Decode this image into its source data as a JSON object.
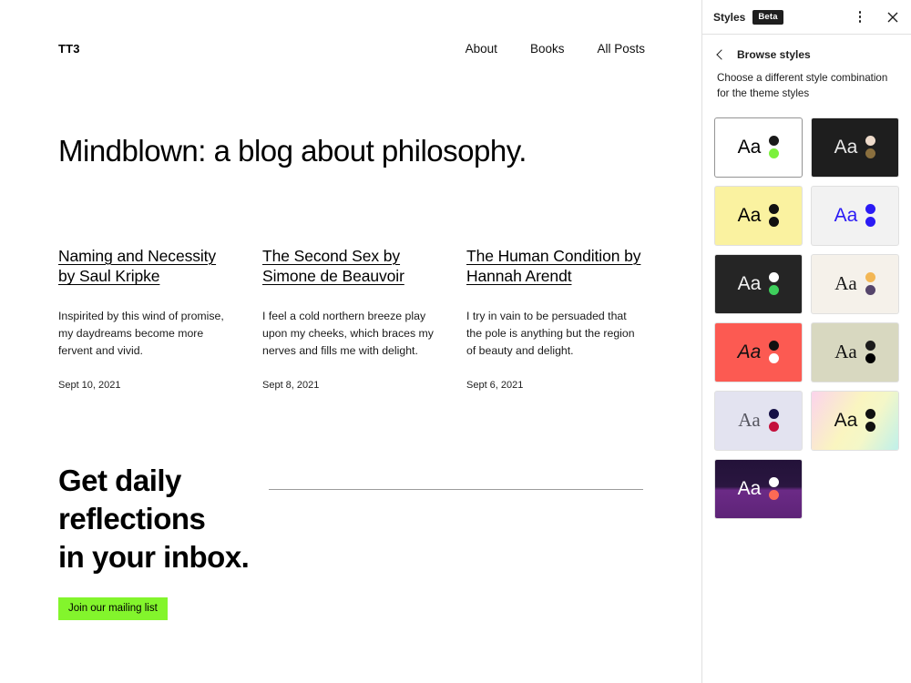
{
  "site": {
    "title": "TT3",
    "nav": [
      {
        "label": "About"
      },
      {
        "label": "Books"
      },
      {
        "label": "All Posts"
      }
    ],
    "hero": "Mindblown: a blog about philosophy.",
    "posts": [
      {
        "title": "Naming and Necessity by Saul Kripke",
        "excerpt": "Inspirited by this wind of promise, my daydreams become more fervent and vivid.",
        "date": "Sept 10, 2021"
      },
      {
        "title": "The Second Sex by Simone de Beauvoir",
        "excerpt": "I feel a cold northern breeze play upon my cheeks, which braces my nerves and fills me with delight.",
        "date": "Sept 8, 2021"
      },
      {
        "title": "The Human Condition by Hannah Arendt",
        "excerpt": "I try in vain to be persuaded that the pole is anything but the region of beauty and delight.",
        "date": "Sept 6, 2021"
      }
    ],
    "cta": {
      "heading": "Get daily\nreflections\nin your inbox.",
      "button_label": "Join our mailing list",
      "button_color": "#83F52C",
      "rule_color": "#9b9b9b"
    }
  },
  "sidebar": {
    "title": "Styles",
    "beta_badge": "Beta",
    "more_menu_icon": "kebab-menu-icon",
    "close_icon": "close-icon",
    "back_icon": "chevron-left-icon",
    "nav_label": "Browse styles",
    "description": "Choose a different style combination for the theme styles",
    "sample_text": "Aa",
    "variations": [
      {
        "name": "default",
        "background": "#ffffff",
        "text_color": "#000000",
        "font": "sans",
        "italic": false,
        "dots": [
          "#1A1A1A",
          "#7CF13D"
        ],
        "active": true
      },
      {
        "name": "dark-bronze",
        "background": "#1E1E1E",
        "text_color": "#E8E8E8",
        "font": "sans",
        "italic": false,
        "dots": [
          "#EEDBCB",
          "#8A6F3E"
        ],
        "active": false
      },
      {
        "name": "yellow",
        "background": "#FAF2A0",
        "text_color": "#000000",
        "font": "sans",
        "italic": false,
        "dots": [
          "#111111",
          "#111111"
        ],
        "active": false
      },
      {
        "name": "light-blue-ink",
        "background": "#F2F2F2",
        "text_color": "#2B1BF5",
        "font": "sans",
        "italic": false,
        "dots": [
          "#2B1BF5",
          "#2B1BF5"
        ],
        "active": false
      },
      {
        "name": "dark-green",
        "background": "#252525",
        "text_color": "#F2F2F2",
        "font": "sans",
        "italic": false,
        "dots": [
          "#FFFFFF",
          "#3ECF5C"
        ],
        "active": false
      },
      {
        "name": "cream-serif",
        "background": "#F5F1EA",
        "text_color": "#1A1A1A",
        "font": "serif",
        "italic": false,
        "dots": [
          "#F3B755",
          "#55456B"
        ],
        "active": false
      },
      {
        "name": "coral-italic",
        "background": "#FC5A52",
        "text_color": "#111111",
        "font": "sans",
        "italic": true,
        "dots": [
          "#111111",
          "#FFFFFF"
        ],
        "active": false
      },
      {
        "name": "sage-serif",
        "background": "#D8D8C0",
        "text_color": "#111111",
        "font": "serif",
        "italic": false,
        "dots": [
          "#1C1C1C",
          "#000000"
        ],
        "active": false
      },
      {
        "name": "lavender-serif",
        "background": "#E3E3F0",
        "text_color": "#55555F",
        "font": "serif",
        "italic": false,
        "dots": [
          "#161046",
          "#C4103C"
        ],
        "active": false
      },
      {
        "name": "pastel-gradient",
        "background": "linear-gradient(120deg, #FBD4EC 0%, #FAF5C0 45%, #F4F7C8 65%, #BFF0EA 100%)",
        "text_color": "#111111",
        "font": "sans",
        "italic": false,
        "dots": [
          "#111111",
          "#111111"
        ],
        "active": false
      },
      {
        "name": "purple-gradient",
        "background": "linear-gradient(180deg, #231239 0%, #2A1640 46%, #6B2A86 52%, #5E2478 100%)",
        "text_color": "#FFFFFF",
        "font": "sans",
        "italic": false,
        "dots": [
          "#FFFFFF",
          "#FC6A55"
        ],
        "active": false
      }
    ]
  }
}
